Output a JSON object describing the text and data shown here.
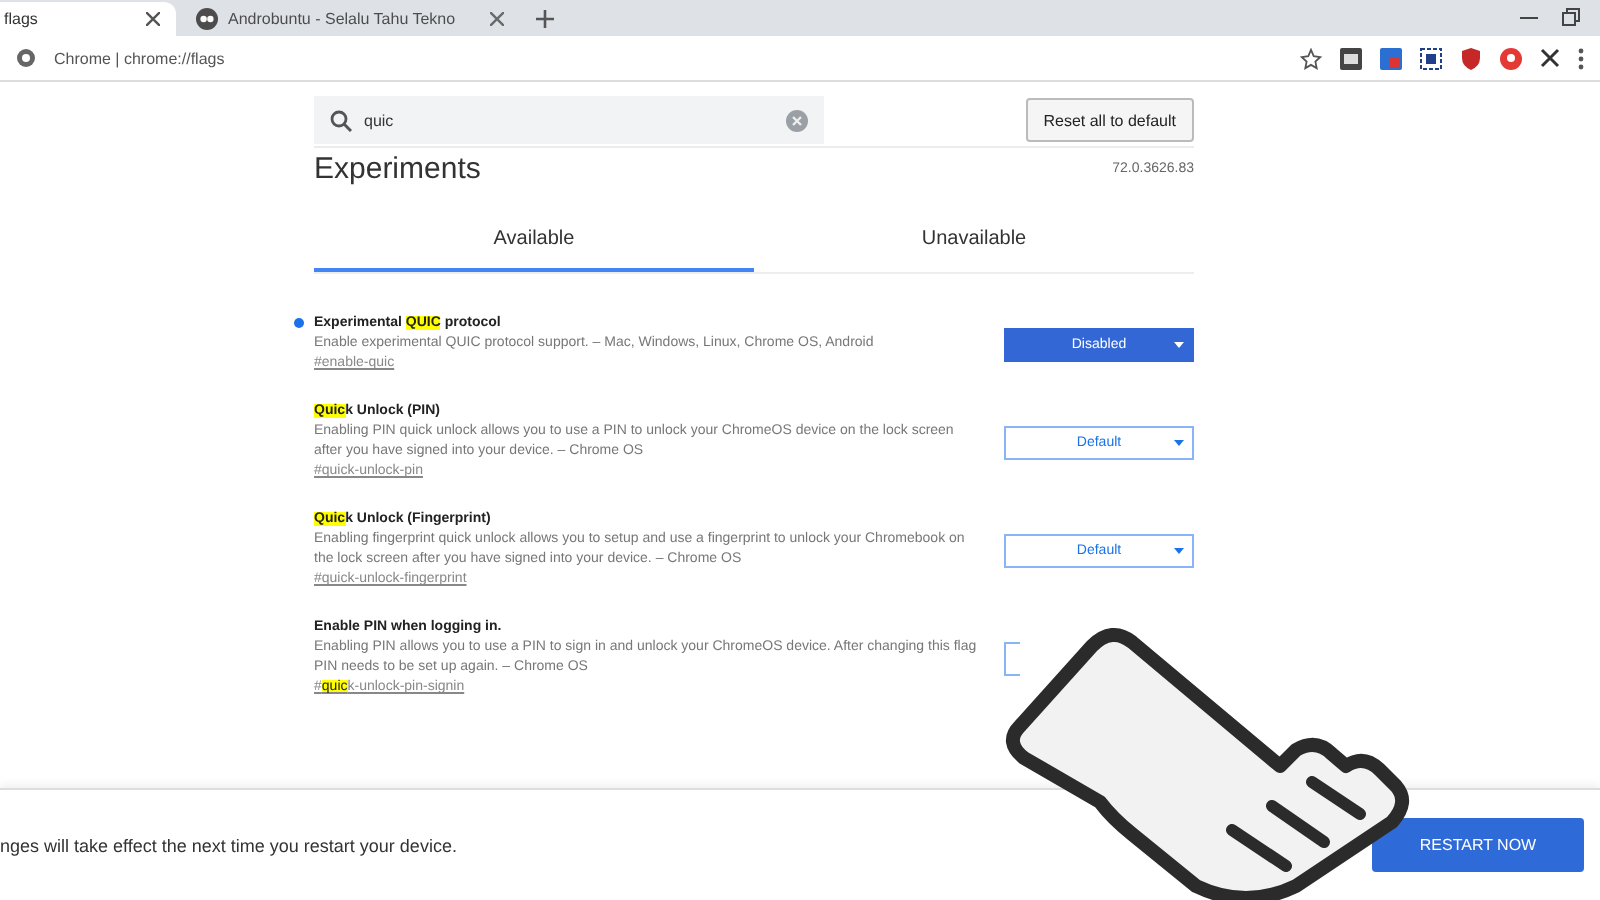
{
  "browser_tabs": [
    {
      "title": "flags",
      "selected": true,
      "favicon": false
    },
    {
      "title": "Androbuntu - Selalu Tahu Tekno",
      "selected": false,
      "favicon": true
    }
  ],
  "address": {
    "site": "Chrome",
    "separator": "|",
    "url": "chrome://flags"
  },
  "search": {
    "value": "quic"
  },
  "reset_button": "Reset all to default",
  "heading": "Experiments",
  "version": "72.0.3626.83",
  "page_tabs": [
    {
      "label": "Available",
      "selected": true
    },
    {
      "label": "Unavailable",
      "selected": false
    }
  ],
  "flags": [
    {
      "title": [
        {
          "text": "Experimental "
        },
        {
          "text": "QUIC",
          "highlight": true
        },
        {
          "text": " protocol"
        }
      ],
      "modified": true,
      "description": "Enable experimental QUIC protocol support. – Mac, Windows, Linux, Chrome OS, Android",
      "link": [
        {
          "text": "#enable-quic"
        }
      ],
      "value": "Disabled"
    },
    {
      "title": [
        {
          "text": "Quic",
          "highlight": true
        },
        {
          "text": "k Unlock (PIN)"
        }
      ],
      "modified": false,
      "description": "Enabling PIN quick unlock allows you to use a PIN to unlock your ChromeOS device on the lock screen after you have signed into your device. – Chrome OS",
      "link": [
        {
          "text": "#quick-unlock-pin"
        }
      ],
      "value": "Default"
    },
    {
      "title": [
        {
          "text": "Quic",
          "highlight": true
        },
        {
          "text": "k Unlock (Fingerprint)"
        }
      ],
      "modified": false,
      "description": "Enabling fingerprint quick unlock allows you to setup and use a fingerprint to unlock your Chromebook on the lock screen after you have signed into your device. – Chrome OS",
      "link": [
        {
          "text": "#quick-unlock-fingerprint"
        }
      ],
      "value": "Default"
    },
    {
      "title": [
        {
          "text": "Enable PIN when logging in."
        }
      ],
      "modified": false,
      "description": "Enabling PIN allows you to use a PIN to sign in and unlock your ChromeOS device. After changing this flag PIN needs to be set up again. – Chrome OS",
      "link": [
        {
          "text": "#"
        },
        {
          "text": "quic",
          "highlight": true
        },
        {
          "text": "k-unlock-pin-signin"
        }
      ]
    }
  ],
  "footer": {
    "message": "nges will take effect the next time you restart your device.",
    "button": "RESTART NOW"
  }
}
